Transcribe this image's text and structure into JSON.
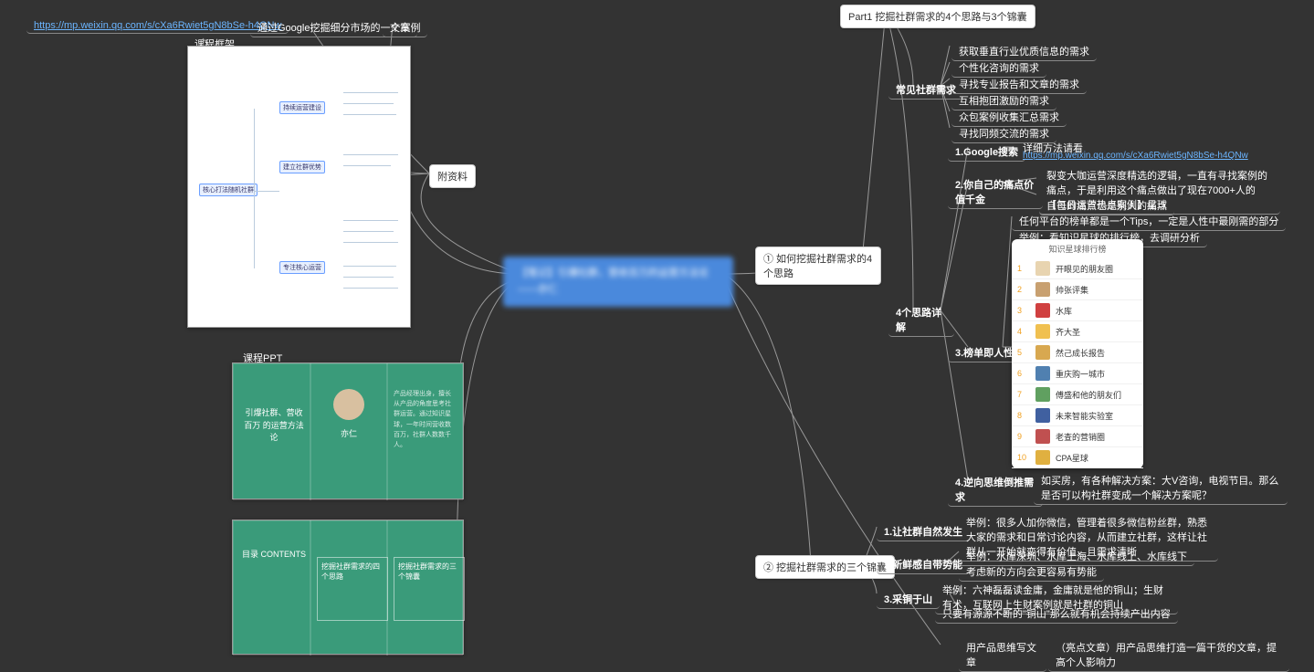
{
  "center": "【笔记】引爆社群，营收百万的运营方法论——亦仁",
  "left": {
    "url": "https://mp.weixin.qq.com/s/cXa6Rwiet5gN8bSe-h4QNw",
    "url_title": "通过Google挖掘细分市场的一个案例",
    "article": "文章",
    "framework": "课程框架",
    "materials": "附资料",
    "ppt_label": "课程PPT",
    "ppt_title": "引爆社群、营收百万\n的运营方法论",
    "ppt_author": "亦仁",
    "ppt2_left": "目录\nCONTENTS",
    "ppt2_mid": "挖掘社群需求的四个思路",
    "ppt2_right": "挖掘社群需求的三个锦囊"
  },
  "right": {
    "part1": "Part1 挖掘社群需求的4个思路与3个锦囊",
    "q1": "① 如何挖掘社群需求的4个思路",
    "q2": "② 挖掘社群需求的三个锦囊",
    "common_needs": "常见社群需求",
    "needs": [
      "获取垂直行业优质信息的需求",
      "个性化咨询的需求",
      "寻找专业报告和文章的需求",
      "互相抱团激励的需求",
      "众包案例收集汇总需求",
      "寻找同频交流的需求"
    ],
    "detailed": "4个思路详解",
    "d1": "1.Google搜索",
    "d1_note": "详细方法请看",
    "d1_link": "https://mp.weixin.qq.com/s/cXa6Rwiet5gN8bSe-h4QNw",
    "d2": "2.你自己的痛点价值千金",
    "d2_note": "裂变大咖运营深度精选的逻辑，一直有寻找案例的痛点，于是利用这个痛点做出了现在7000+人的【每日运营热点案例】星球",
    "d2_note2": "自己的痛点也是别人的痛点",
    "d3": "3.榜单即人性",
    "d3_note": "任何平台的榜单都是一个Tips，一定是人性中最刚需的部分",
    "d3_example": "举例：看知识星球的排行榜，去调研分析",
    "d4": "4.逆向思维倒推需求",
    "d4_note": "如买房，有各种解决方案：大V咨询，电视节目。那么是否可以构社群变成一个解决方案呢？",
    "t1": "1.让社群自然发生",
    "t1_note": "举例：很多人加你微信，管理着很多微信粉丝群，熟悉大家的需求和日常讨论内容，从而建立社群，这样让社群从一开始就变得有价值，且需求清晰",
    "t2": "2.新鲜感自带势能",
    "t2_note": "举例：水库深圳、水库上海、水库线上、水库线下",
    "t2_note2": "考虑新的方向会更容易有势能",
    "t3": "3.采铜于山",
    "t3_note": "举例：六神磊磊读金庸，金庸就是他的铜山；生财有术，互联网上生财案例就是社群的铜山",
    "t3_note2": "只要有源源不断的\"铜山\"那么就有机会持续产出内容",
    "bottom_left": "用产品思维写文章",
    "bottom_right": "（亮点文章）用产品思维打造一篇干货的文章，提高个人影响力"
  },
  "rank": {
    "header": "知识星球排行榜",
    "items": [
      {
        "n": "1",
        "name": "开眼见的朋友圈"
      },
      {
        "n": "2",
        "name": "帅张评集"
      },
      {
        "n": "3",
        "name": "水库"
      },
      {
        "n": "4",
        "name": "齐大圣"
      },
      {
        "n": "5",
        "name": "然己成长报告"
      },
      {
        "n": "6",
        "name": "重庆购一城市"
      },
      {
        "n": "7",
        "name": "傅盛和他的朋友们"
      },
      {
        "n": "8",
        "name": "未来智能实验室"
      },
      {
        "n": "9",
        "name": "老查的营销圈"
      },
      {
        "n": "10",
        "name": "CPA星球"
      }
    ],
    "colors": [
      "#e8d4b0",
      "#c8a070",
      "#d04040",
      "#f0c050",
      "#d8a850",
      "#5080b0",
      "#60a060",
      "#4060a0",
      "#c05050",
      "#e0b040"
    ]
  }
}
